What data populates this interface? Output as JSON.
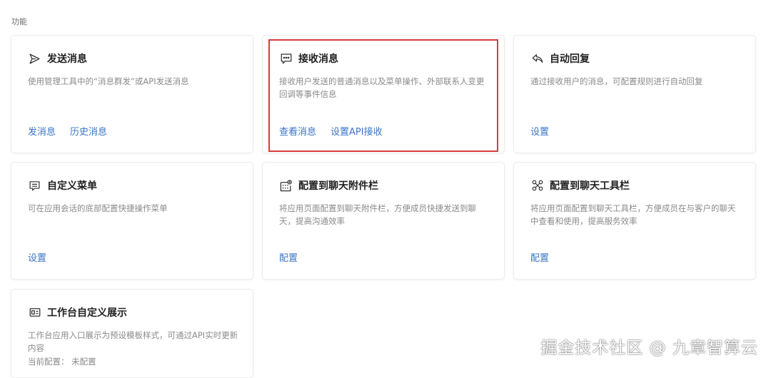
{
  "section": {
    "title": "功能"
  },
  "cards": [
    {
      "title": "发送消息",
      "icon": "send-icon",
      "desc": "使用管理工具中的“消息群发”或API发送消息",
      "actions": [
        "发消息",
        "历史消息"
      ]
    },
    {
      "title": "接收消息",
      "icon": "chat-bubble-icon",
      "desc": "接收用户发送的普通消息以及菜单操作、外部联系人变更回调等事件信息",
      "actions": [
        "查看消息",
        "设置API接收"
      ]
    },
    {
      "title": "自动回复",
      "icon": "reply-icon",
      "desc": "通过接收用户的消息，可配置规则进行自动回复",
      "actions": [
        "设置"
      ]
    },
    {
      "title": "自定义菜单",
      "icon": "menu-icon",
      "desc": "可在应用会话的底部配置快捷操作菜单",
      "actions": [
        "设置"
      ]
    },
    {
      "title": "配置到聊天附件栏",
      "icon": "attachment-grid-icon",
      "desc": "将应用页面配置到聊天附件栏，方便成员快捷发送到聊天，提高沟通效率",
      "actions": [
        "配置"
      ]
    },
    {
      "title": "配置到聊天工具栏",
      "icon": "toolbar-icon",
      "desc": "将应用页面配置到聊天工具栏，方便成员在与客户的聊天中查看和使用，提高服务效率",
      "actions": [
        "配置"
      ]
    },
    {
      "title": "工作台自定义展示",
      "icon": "workbench-icon",
      "desc": "工作台应用入口展示为预设模板样式，可通过API实时更新内容",
      "status_label": "当前配置：",
      "status_value": "未配置"
    }
  ],
  "watermark": "掘金技术社区 @ 九章智算云",
  "colors": {
    "link": "#3975c6",
    "highlight": "#d93b3b"
  }
}
